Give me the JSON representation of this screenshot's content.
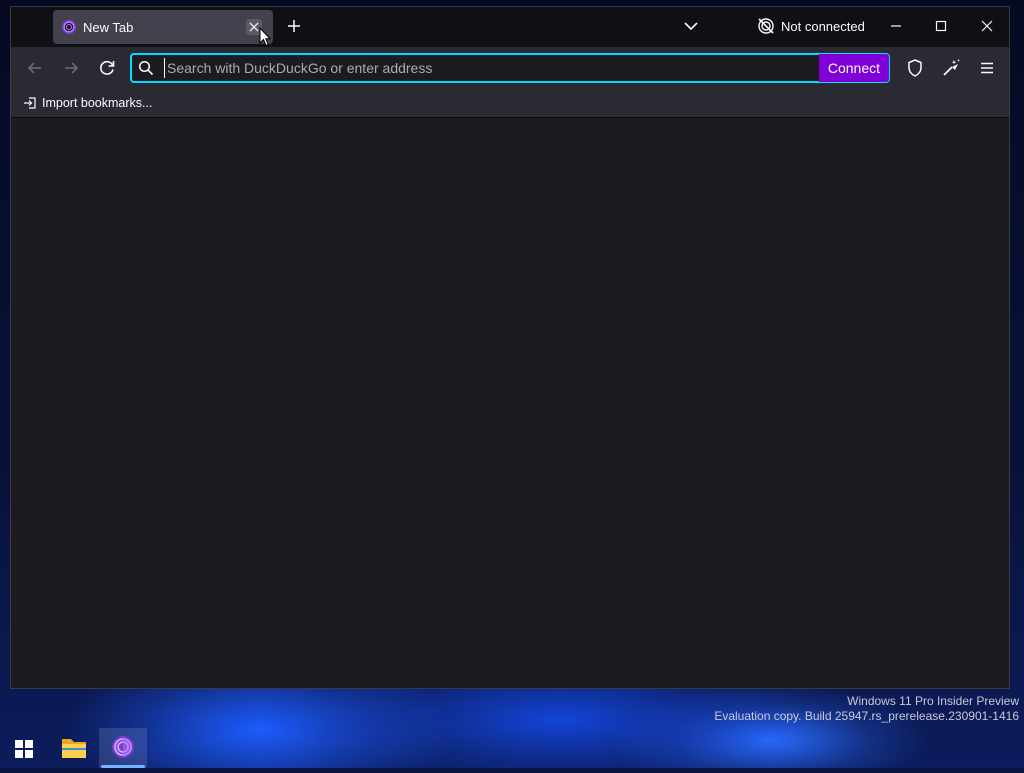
{
  "browser": {
    "tab": {
      "title": "New Tab"
    },
    "status": {
      "label": "Not connected"
    },
    "urlbar": {
      "placeholder": "Search with DuckDuckGo or enter address",
      "connect_label": "Connect"
    },
    "bookmarks": {
      "import_label": "Import bookmarks..."
    }
  },
  "watermark": {
    "line1": "Windows 11 Pro Insider Preview",
    "line2": "Evaluation copy. Build 25947.rs_prerelease.230901-1416"
  },
  "colors": {
    "accent_focus": "#00ddff",
    "connect_purple": "#8000d7",
    "toolbar": "#2b2a33",
    "content_bg": "#1c1b22"
  },
  "icons": {
    "tab_favicon": "tor-onion-icon",
    "tab_close": "close-icon",
    "new_tab": "plus-icon",
    "tab_list": "chevron-down-icon",
    "network": "tor-circuit-off-icon",
    "back": "arrow-left-icon",
    "forward": "arrow-right-icon",
    "reload": "reload-icon",
    "search": "search-icon",
    "shield": "shield-icon",
    "new_identity": "broom-sparkle-icon",
    "menu": "hamburger-menu-icon",
    "import": "import-icon"
  }
}
